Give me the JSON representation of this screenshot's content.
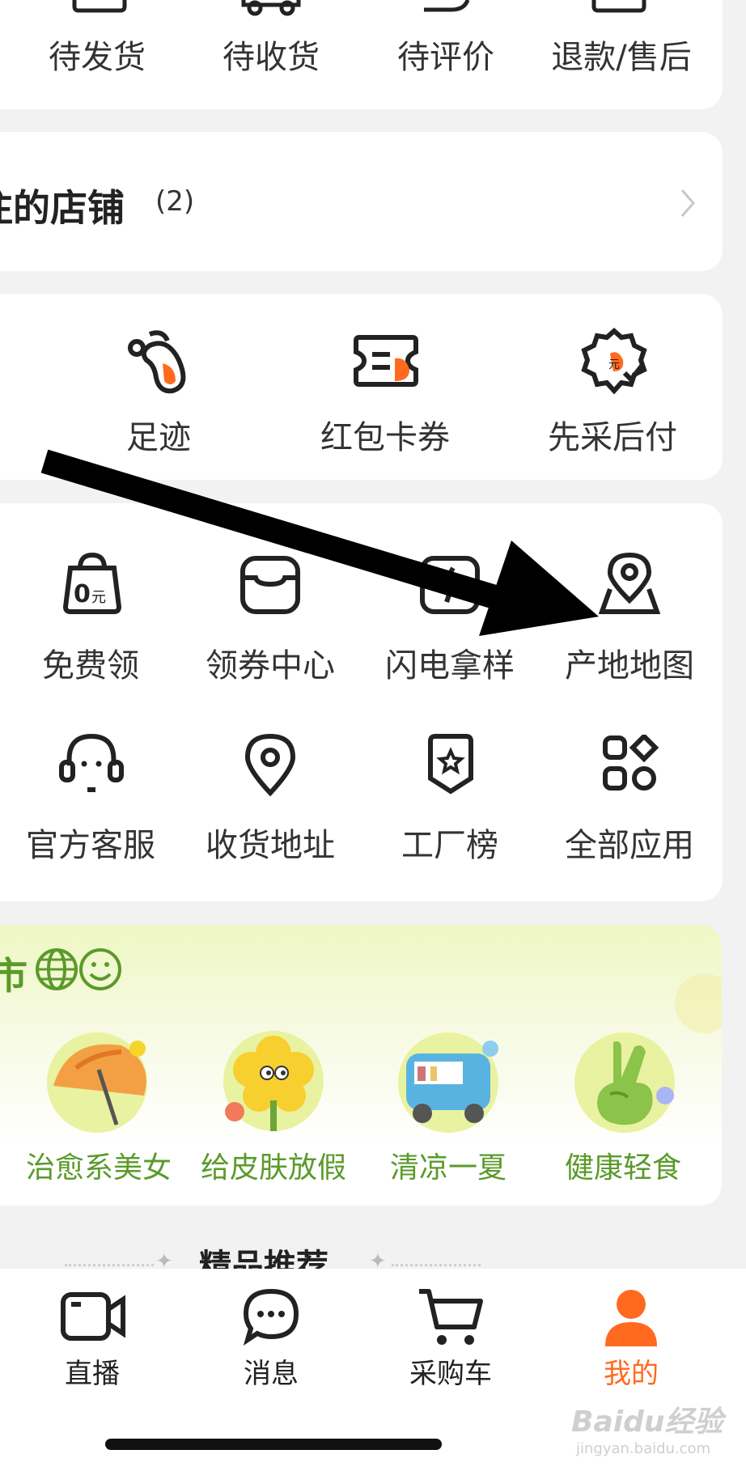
{
  "orders": {
    "items": [
      {
        "label": "待发货",
        "icon": "box-icon"
      },
      {
        "label": "待收货",
        "icon": "truck-icon"
      },
      {
        "label": "待评价",
        "icon": "comment-icon"
      },
      {
        "label": "退款/售后",
        "icon": "refund-icon"
      }
    ]
  },
  "followed_shops": {
    "title": "注的店铺",
    "count": "(2)"
  },
  "quick_tools": [
    {
      "label": "足迹",
      "icon": "footprint-icon"
    },
    {
      "label": "红包卡券",
      "icon": "coupon-ticket-icon"
    },
    {
      "label": "先采后付",
      "icon": "buy-later-pay-icon"
    }
  ],
  "services": {
    "row1": [
      {
        "label": "免费领",
        "icon": "free-bag-icon",
        "badge": "0元"
      },
      {
        "label": "领券中心",
        "icon": "coupon-center-icon"
      },
      {
        "label": "闪电拿样",
        "icon": "lightning-sample-icon"
      },
      {
        "label": "产地地图",
        "icon": "origin-map-icon"
      }
    ],
    "row2": [
      {
        "label": "官方客服",
        "icon": "headset-icon"
      },
      {
        "label": "收货地址",
        "icon": "location-pin-icon"
      },
      {
        "label": "工厂榜",
        "icon": "factory-rank-icon"
      },
      {
        "label": "全部应用",
        "icon": "all-apps-icon"
      }
    ]
  },
  "market": {
    "title": "市",
    "items": [
      {
        "label": "治愈系美女",
        "icon": "umbrella-icon"
      },
      {
        "label": "给皮肤放假",
        "icon": "flower-icon"
      },
      {
        "label": "清凉一夏",
        "icon": "bus-icon"
      },
      {
        "label": "健康轻食",
        "icon": "victory-hand-icon"
      }
    ]
  },
  "recommend": {
    "title": "精品推荐"
  },
  "tabbar": [
    {
      "label": "直播",
      "icon": "video-camera-icon",
      "active": false
    },
    {
      "label": "消息",
      "icon": "chat-bubble-icon",
      "active": false
    },
    {
      "label": "采购车",
      "icon": "cart-icon",
      "active": false
    },
    {
      "label": "我的",
      "icon": "person-icon",
      "active": true
    }
  ],
  "watermark": {
    "text": "Baidu经验",
    "sub": "jingyan.baidu.com"
  },
  "colors": {
    "accent": "#ff6a1f",
    "green": "#5a9a2a",
    "background": "#f2f2f2"
  }
}
